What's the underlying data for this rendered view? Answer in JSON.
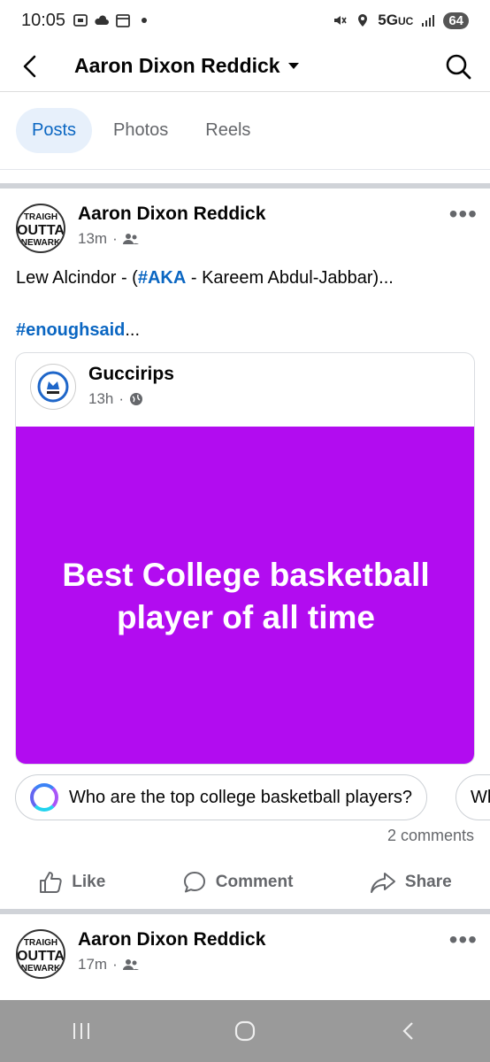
{
  "status_bar": {
    "time": "10:05",
    "network": "5G",
    "network_suffix": "UC",
    "battery": "64"
  },
  "header": {
    "title": "Aaron Dixon Reddick"
  },
  "tabs": [
    {
      "label": "Posts",
      "active": true
    },
    {
      "label": "Photos",
      "active": false
    },
    {
      "label": "Reels",
      "active": false
    }
  ],
  "post1": {
    "author": "Aaron Dixon Reddick",
    "avatar_text": [
      "TRAIGH",
      "OUTTA",
      "NEWARK"
    ],
    "time": "13m",
    "audience_icon": "friends-icon",
    "text_prefix": "Lew Alcindor - (",
    "text_tag": "#AKA",
    "text_suffix": " - Kareem Abdul-Jabbar)...",
    "hashtag": "#enoughsaid",
    "hashtag_suffix": "...",
    "shared": {
      "author": "Guccirips",
      "time": "13h",
      "audience_icon": "globe-icon",
      "background_color": "#b20cf0",
      "text": "Best College basketball player of all time"
    },
    "suggestions": [
      "Who are the top college basketball players?",
      "Wh"
    ],
    "comments": "2 comments",
    "actions": {
      "like": "Like",
      "comment": "Comment",
      "share": "Share"
    }
  },
  "post2": {
    "author": "Aaron Dixon Reddick",
    "avatar_text": [
      "TRAIGH",
      "OUTTA",
      "NEWARK"
    ],
    "time": "17m",
    "audience_icon": "friends-icon"
  }
}
